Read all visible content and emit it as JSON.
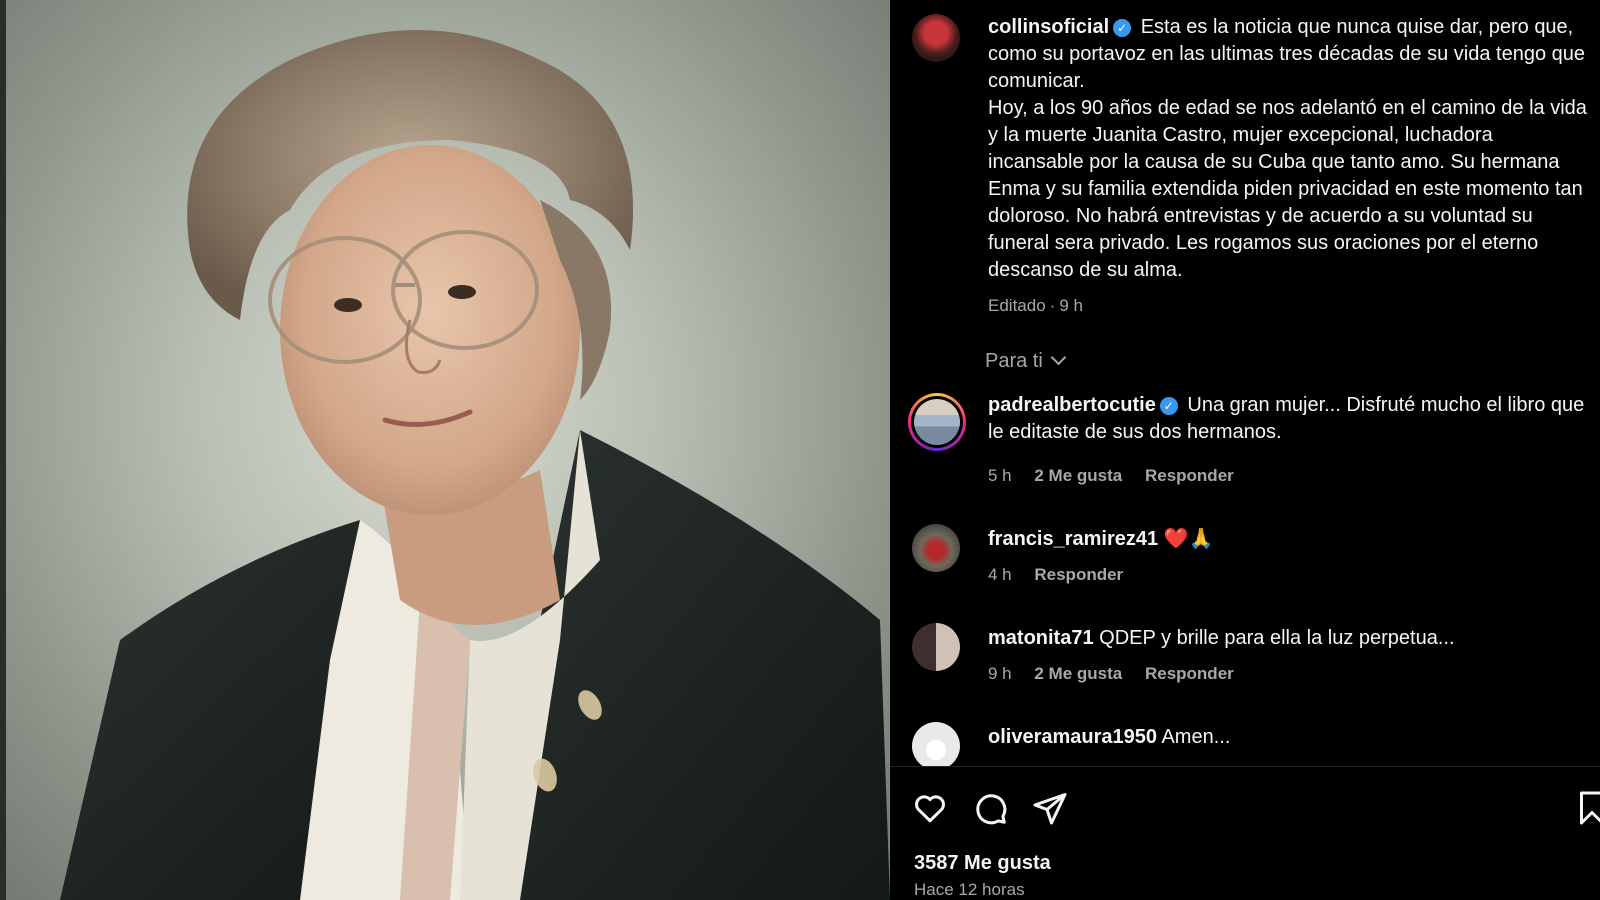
{
  "post": {
    "author": "collinsoficial",
    "caption": "Esta es la noticia que nunca quise dar, pero que, como su portavoz en las ultimas tres décadas de su vida tengo que comunicar.",
    "caption_2": "Hoy, a los 90 años de edad se nos adelantó en el camino de la vida y la muerte Juanita Castro, mujer excepcional, luchadora incansable por la causa de su Cuba que tanto amo. Su hermana Enma y su familia extendida piden privacidad en este momento tan doloroso. No habrá entrevistas y de acuerdo a su voluntad su funeral sera privado. Les rogamos sus oraciones por el eterno descanso de su alma.",
    "edited": "Editado",
    "time": "9 h",
    "likes": "3587 Me gusta",
    "time_ago": "Hace 12 horas"
  },
  "filter": {
    "label": "Para ti"
  },
  "comments": [
    {
      "user": "padrealbertocutie",
      "verified": true,
      "text": "Una gran mujer... Disfruté mucho el libro que le editaste de sus dos hermanos.",
      "time": "5 h",
      "likes": "2 Me gusta",
      "reply": "Responder"
    },
    {
      "user": "francis_ramirez41",
      "verified": false,
      "text": "❤️🙏",
      "time": "4 h",
      "likes": "",
      "reply": "Responder"
    },
    {
      "user": "matonita71",
      "verified": false,
      "text": "QDEP y brille para ella la luz perpetua...",
      "time": "9 h",
      "likes": "2 Me gusta",
      "reply": "Responder"
    },
    {
      "user": "oliveramaura1950",
      "verified": false,
      "text": "Amen...",
      "time": "",
      "likes": "",
      "reply": ""
    }
  ],
  "icons": {
    "like": "heart-icon",
    "comment": "comment-icon",
    "share": "share-icon",
    "save": "bookmark-icon",
    "verified": "verified-badge-icon"
  },
  "colors": {
    "background": "#000000",
    "text": "#f5f5f5",
    "muted": "#a8a8a8",
    "verified": "#3897f0"
  }
}
